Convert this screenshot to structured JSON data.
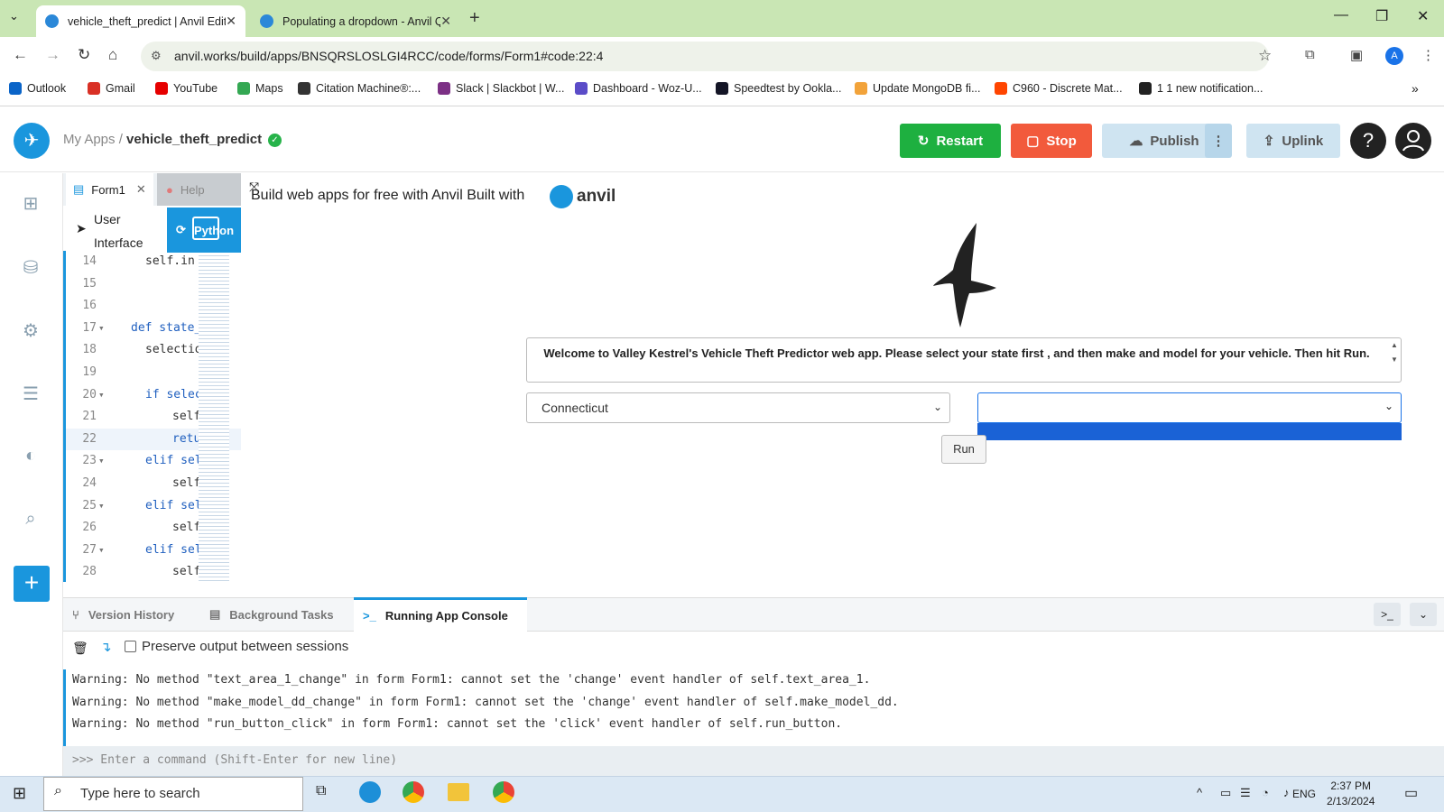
{
  "browser": {
    "tabs": [
      {
        "title": "vehicle_theft_predict | Anvil Edit"
      },
      {
        "title": "Populating a dropdown - Anvil Q"
      }
    ],
    "url": "anvil.works/build/apps/BNSQRSLOSLGI4RCC/code/forms/Form1#code:22:4",
    "bookmarks": [
      {
        "label": "Outlook",
        "color": "#0a64c8"
      },
      {
        "label": "Gmail",
        "color": "#d93025"
      },
      {
        "label": "YouTube",
        "color": "#e60000"
      },
      {
        "label": "Maps",
        "color": "#34a853"
      },
      {
        "label": "Citation Machine®:...",
        "color": "#333333"
      },
      {
        "label": "Slack | Slackbot | W...",
        "color": "#7c3085"
      },
      {
        "label": "Dashboard - Woz-U...",
        "color": "#5b4cc8"
      },
      {
        "label": "Speedtest by Ookla...",
        "color": "#141526"
      },
      {
        "label": "Update MongoDB fi...",
        "color": "#f2a33a"
      },
      {
        "label": "C960 - Discrete Mat...",
        "color": "#ff4500"
      },
      {
        "label": "1 1 new notification...",
        "color": "#222222"
      }
    ]
  },
  "header": {
    "breadcrumb_root": "My Apps",
    "breadcrumb_sep": "/",
    "app_name": "vehicle_theft_predict",
    "restart": "Restart",
    "stop": "Stop",
    "publish": "Publish",
    "uplink": "Uplink",
    "help": "?"
  },
  "editor": {
    "tab_form": "Form1",
    "tab_help": "Help",
    "ui_tab": "User Interface",
    "py_tab": "Python",
    "lines": [
      {
        "n": "14",
        "text": "self.in",
        "indent": 2
      },
      {
        "n": "15",
        "text": "",
        "indent": 0
      },
      {
        "n": "16",
        "text": "",
        "indent": 0
      },
      {
        "n": "17",
        "text": "def state_",
        "indent": 1,
        "fold": true,
        "kw": true
      },
      {
        "n": "18",
        "text": "selectio",
        "indent": 2
      },
      {
        "n": "19",
        "text": "",
        "indent": 0
      },
      {
        "n": "20",
        "text": "if selec",
        "indent": 2,
        "fold": true,
        "kw": true
      },
      {
        "n": "21",
        "text": "self",
        "indent": 3
      },
      {
        "n": "22",
        "text": "retu",
        "indent": 3,
        "kw": true,
        "active": true
      },
      {
        "n": "23",
        "text": "elif sel",
        "indent": 2,
        "fold": true,
        "kw": true
      },
      {
        "n": "24",
        "text": "self",
        "indent": 3
      },
      {
        "n": "25",
        "text": "elif sel",
        "indent": 2,
        "fold": true,
        "kw": true
      },
      {
        "n": "26",
        "text": "self",
        "indent": 3
      },
      {
        "n": "27",
        "text": "elif sel",
        "indent": 2,
        "fold": true,
        "kw": true
      },
      {
        "n": "28",
        "text": "self",
        "indent": 3
      }
    ]
  },
  "preview": {
    "built_text": "Build web apps for free with Anvil Built with",
    "anvil_logo": "anvil",
    "welcome": "Welcome to Valley Kestrel's Vehicle Theft Predictor web app. Please select your state first , and then make and model for your vehicle. Then hit Run.",
    "state_value": "Connecticut",
    "make_model_value": "",
    "run_label": "Run"
  },
  "bottom": {
    "tabs": [
      "Version History",
      "Background Tasks",
      "Running App Console"
    ],
    "preserve_label": "Preserve output between sessions",
    "output": [
      "Warning: No method \"text_area_1_change\" in form Form1: cannot set the 'change' event handler of self.text_area_1.",
      "Warning: No method \"make_model_dd_change\" in form Form1: cannot set the 'change' event handler of self.make_model_dd.",
      "Warning: No method \"run_button_click\" in form Form1: cannot set the 'click' event handler of self.run_button."
    ],
    "prompt": ">>> Enter a command (Shift-Enter for new line)"
  },
  "taskbar": {
    "search_placeholder": "Type here to search",
    "lang": "ENG",
    "time": "2:37 PM",
    "date": "2/13/2024"
  }
}
